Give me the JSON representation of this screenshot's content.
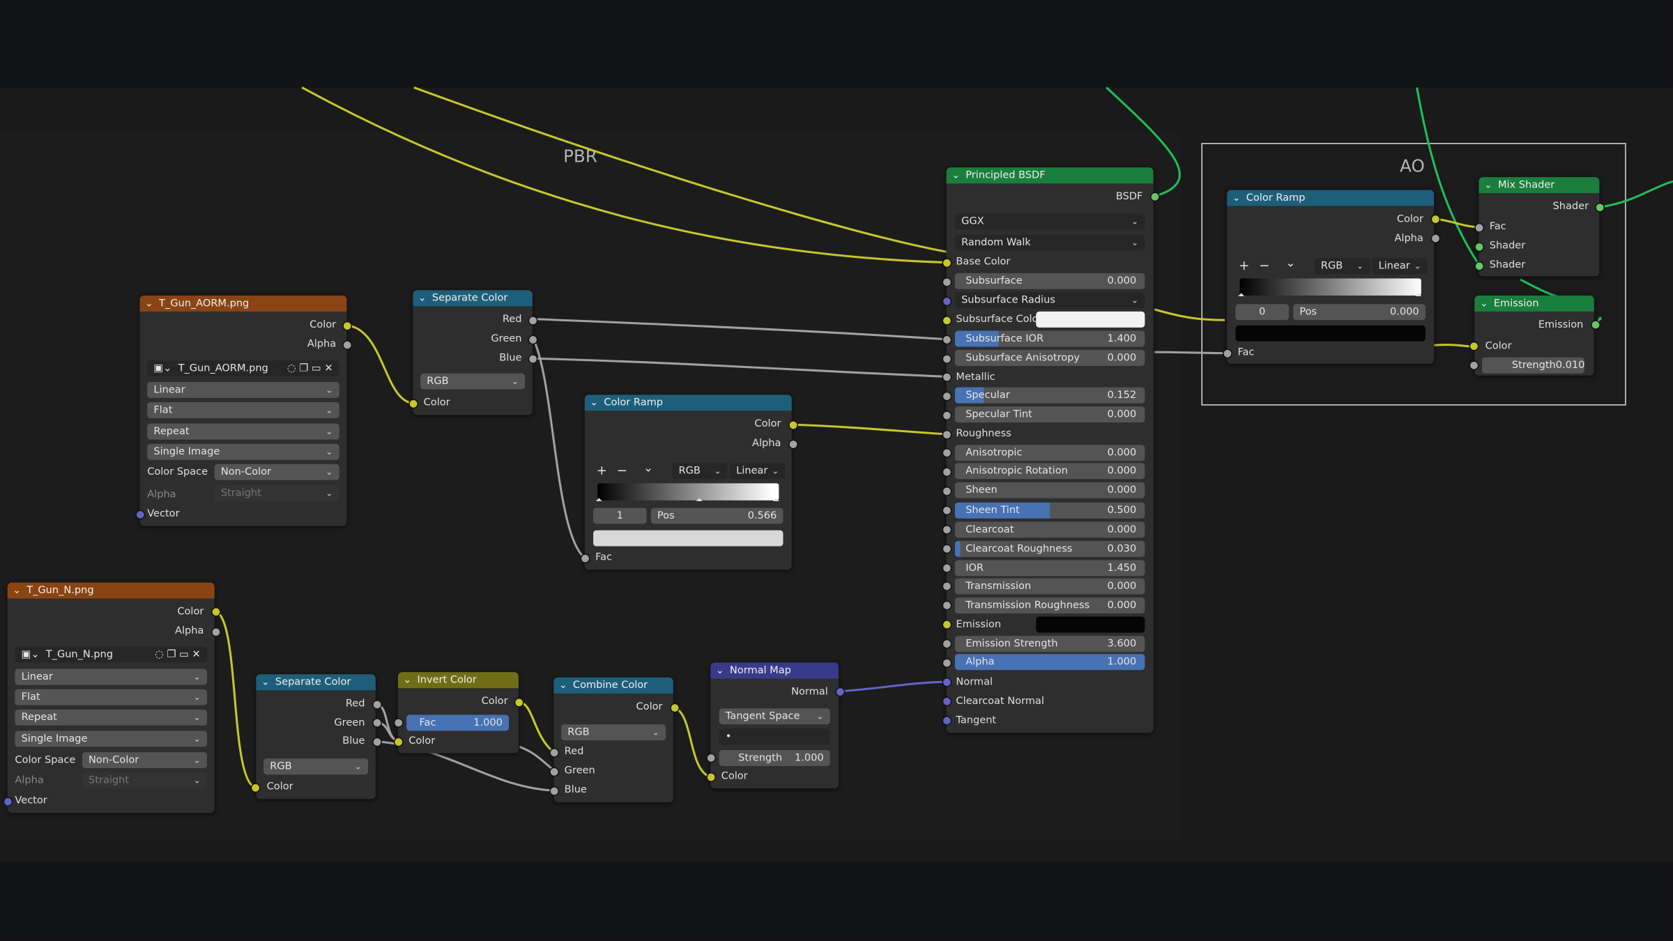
{
  "frames": {
    "pbr": "PBR",
    "ao": "AO"
  },
  "aorm_tex": {
    "title": "T_Gun_AORM.png",
    "outputs": [
      "Color",
      "Alpha"
    ],
    "image_name": "T_Gun_AORM.png",
    "interpolation": "Linear",
    "projection": "Flat",
    "extension": "Repeat",
    "source": "Single Image",
    "color_space_label": "Color Space",
    "color_space": "Non-Color",
    "alpha_label": "Alpha",
    "alpha_mode": "Straight",
    "input": "Vector"
  },
  "sep1": {
    "title": "Separate Color",
    "outputs": [
      "Red",
      "Green",
      "Blue"
    ],
    "mode": "RGB",
    "input": "Color"
  },
  "ramp1": {
    "title": "Color Ramp",
    "outputs": [
      "Color",
      "Alpha"
    ],
    "plus": "+",
    "minus": "−",
    "down": "⌄",
    "mode": "RGB",
    "interp": "Linear",
    "index": "1",
    "pos_label": "Pos",
    "pos": "0.566",
    "input": "Fac"
  },
  "principled": {
    "title": "Principled BSDF",
    "output": "BSDF",
    "distribution": "GGX",
    "subsurface_method": "Random Walk",
    "base_color": "Base Color",
    "subsurface": {
      "label": "Subsurface",
      "value": "0.000"
    },
    "subsurface_radius": "Subsurface Radius",
    "subsurface_color": "Subsurface Color",
    "subsurface_ior": {
      "label": "Subsurface IOR",
      "value": "1.400",
      "fill": 0.23
    },
    "subsurface_anisotropy": {
      "label": "Subsurface Anisotropy",
      "value": "0.000"
    },
    "metallic": "Metallic",
    "specular": {
      "label": "Specular",
      "value": "0.152",
      "fill": 0.152
    },
    "specular_tint": {
      "label": "Specular Tint",
      "value": "0.000"
    },
    "roughness": "Roughness",
    "anisotropic": {
      "label": "Anisotropic",
      "value": "0.000"
    },
    "anisotropic_rotation": {
      "label": "Anisotropic Rotation",
      "value": "0.000"
    },
    "sheen": {
      "label": "Sheen",
      "value": "0.000"
    },
    "sheen_tint": {
      "label": "Sheen Tint",
      "value": "0.500",
      "fill": 0.5
    },
    "clearcoat": {
      "label": "Clearcoat",
      "value": "0.000"
    },
    "clearcoat_roughness": {
      "label": "Clearcoat Roughness",
      "value": "0.030",
      "fill": 0.03
    },
    "ior": {
      "label": "IOR",
      "value": "1.450"
    },
    "transmission": {
      "label": "Transmission",
      "value": "0.000"
    },
    "transmission_roughness": {
      "label": "Transmission Roughness",
      "value": "0.000"
    },
    "emission": "Emission",
    "emission_strength": {
      "label": "Emission Strength",
      "value": "3.600"
    },
    "alpha": {
      "label": "Alpha",
      "value": "1.000",
      "fill": 1.0
    },
    "normal": "Normal",
    "clearcoat_normal": "Clearcoat Normal",
    "tangent": "Tangent"
  },
  "ramp_ao": {
    "title": "Color Ramp",
    "outputs": [
      "Color",
      "Alpha"
    ],
    "plus": "+",
    "minus": "−",
    "down": "⌄",
    "mode": "RGB",
    "interp": "Linear",
    "index": "0",
    "pos_label": "Pos",
    "pos": "0.000",
    "input": "Fac"
  },
  "mix": {
    "title": "Mix Shader",
    "output": "Shader",
    "inputs": [
      "Fac",
      "Shader",
      "Shader"
    ]
  },
  "emission": {
    "title": "Emission",
    "output": "Emission",
    "input_color": "Color",
    "strength_label": "Strength",
    "strength": "0.010"
  },
  "n_tex": {
    "title": "T_Gun_N.png",
    "outputs": [
      "Color",
      "Alpha"
    ],
    "image_name": "T_Gun_N.png",
    "interpolation": "Linear",
    "projection": "Flat",
    "extension": "Repeat",
    "source": "Single Image",
    "color_space_label": "Color Space",
    "color_space": "Non-Color",
    "alpha_label": "Alpha",
    "alpha_mode": "Straight",
    "input": "Vector"
  },
  "sep2": {
    "title": "Separate Color",
    "outputs": [
      "Red",
      "Green",
      "Blue"
    ],
    "mode": "RGB",
    "input": "Color"
  },
  "invert": {
    "title": "Invert Color",
    "output": "Color",
    "fac_label": "Fac",
    "fac": "1.000",
    "input": "Color"
  },
  "combine": {
    "title": "Combine Color",
    "output": "Color",
    "mode": "RGB",
    "inputs": [
      "Red",
      "Green",
      "Blue"
    ]
  },
  "normalmap": {
    "title": "Normal Map",
    "output": "Normal",
    "space": "Tangent Space",
    "uv": "•",
    "strength_label": "Strength",
    "strength": "1.000",
    "input": "Color"
  },
  "colors": {
    "link_yellow": "#c7c729",
    "link_gray": "#a1a1a1",
    "link_purple": "#6363c7",
    "link_green": "#1fbf5a"
  }
}
